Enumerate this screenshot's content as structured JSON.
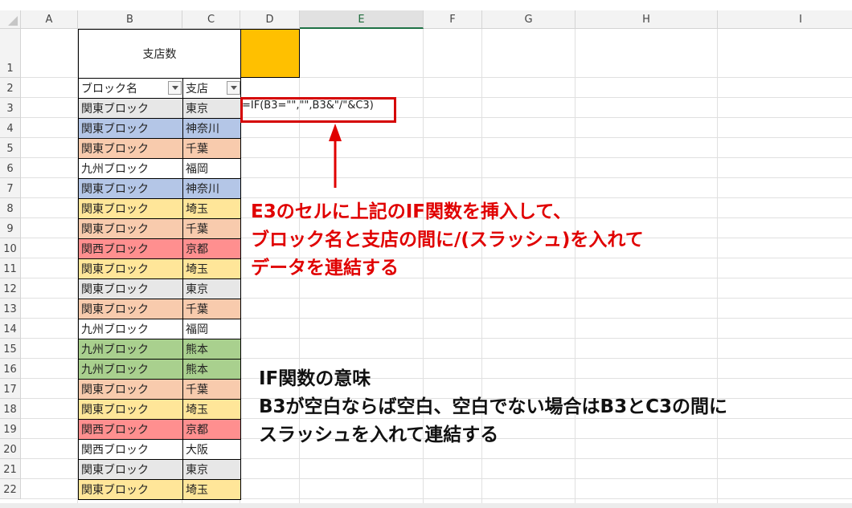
{
  "columns": [
    "A",
    "B",
    "C",
    "D",
    "E",
    "F",
    "G",
    "H",
    "I"
  ],
  "selected_column": "E",
  "rows": [
    "1",
    "2",
    "3",
    "4",
    "5",
    "6",
    "7",
    "8",
    "9",
    "10",
    "11",
    "12",
    "13",
    "14",
    "15",
    "16",
    "17",
    "18",
    "19",
    "20",
    "21",
    "22"
  ],
  "table": {
    "title": "支店数",
    "headers": [
      "ブロック名",
      "支店"
    ],
    "rows": [
      {
        "block": "関東ブロック",
        "branch": "東京",
        "color": "#e7e7e7"
      },
      {
        "block": "関東ブロック",
        "branch": "神奈川",
        "color": "#b4c6e7"
      },
      {
        "block": "関東ブロック",
        "branch": "千葉",
        "color": "#f8cbad"
      },
      {
        "block": "九州ブロック",
        "branch": "福岡",
        "color": "#ffffff"
      },
      {
        "block": "関東ブロック",
        "branch": "神奈川",
        "color": "#b4c6e7"
      },
      {
        "block": "関東ブロック",
        "branch": "埼玉",
        "color": "#ffe699"
      },
      {
        "block": "関東ブロック",
        "branch": "千葉",
        "color": "#f8cbad"
      },
      {
        "block": "関西ブロック",
        "branch": "京都",
        "color": "#ff8f8f"
      },
      {
        "block": "関東ブロック",
        "branch": "埼玉",
        "color": "#ffe699"
      },
      {
        "block": "関東ブロック",
        "branch": "東京",
        "color": "#e7e7e7"
      },
      {
        "block": "関東ブロック",
        "branch": "千葉",
        "color": "#f8cbad"
      },
      {
        "block": "九州ブロック",
        "branch": "福岡",
        "color": "#ffffff"
      },
      {
        "block": "九州ブロック",
        "branch": "熊本",
        "color": "#a9d08e"
      },
      {
        "block": "九州ブロック",
        "branch": "熊本",
        "color": "#a9d08e"
      },
      {
        "block": "関東ブロック",
        "branch": "千葉",
        "color": "#f8cbad"
      },
      {
        "block": "関東ブロック",
        "branch": "埼玉",
        "color": "#ffe699"
      },
      {
        "block": "関西ブロック",
        "branch": "京都",
        "color": "#ff8f8f"
      },
      {
        "block": "関西ブロック",
        "branch": "大阪",
        "color": "#ffffff"
      },
      {
        "block": "関東ブロック",
        "branch": "東京",
        "color": "#e7e7e7"
      },
      {
        "block": "関東ブロック",
        "branch": "埼玉",
        "color": "#ffe699"
      }
    ]
  },
  "highlight_cell_color": "#ffc000",
  "formula": "=IF(B3=\"\",\"\",B3&\"/\"&C3)",
  "annotation_red": [
    "E3のセルに上記のIF関数を挿入して、",
    "ブロック名と支店の間に/(スラッシュ)を入れて",
    "データを連結する"
  ],
  "annotation_black": [
    "IF関数の意味",
    "B3が空白ならば空白、空白でない場合はB3とC3の間に",
    "スラッシュを入れて連結する"
  ]
}
